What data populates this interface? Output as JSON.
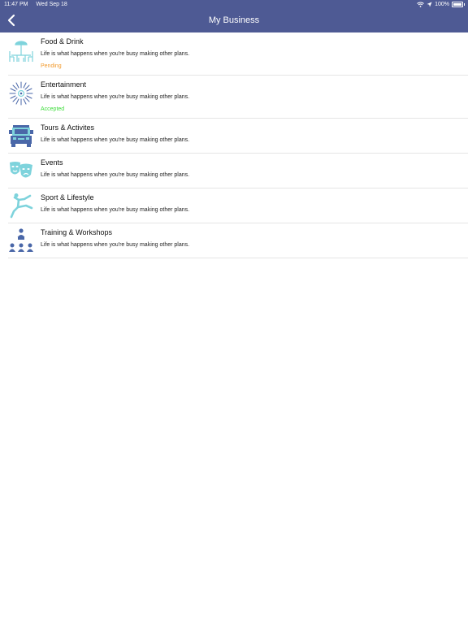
{
  "status_bar": {
    "time": "11:47 PM",
    "date": "Wed Sep 18",
    "battery": "100%"
  },
  "nav": {
    "title": "My Business",
    "back_icon": "chevron-left-icon"
  },
  "colors": {
    "header": "#4e5a94",
    "pending": "#f29a2e",
    "accepted": "#3ddc3a",
    "icon_teal": "#7ed3dc",
    "icon_blue": "#4a67a8"
  },
  "items": [
    {
      "name": "Food & Drink",
      "description": "Life is what happens when you're busy making other plans.",
      "status": "Pending",
      "icon": "food-drink-icon"
    },
    {
      "name": "Entertainment",
      "description": "Life is what happens when you're busy making other plans.",
      "status": "Accepted",
      "icon": "fireworks-icon"
    },
    {
      "name": "Tours & Activites",
      "description": "Life is what happens when you're busy making other plans.",
      "icon": "tour-bus-icon"
    },
    {
      "name": "Events",
      "description": "Life is what happens when you're busy making other plans.",
      "icon": "theater-masks-icon"
    },
    {
      "name": "Sport & Lifestyle",
      "description": "Life is what happens when you're busy making other plans.",
      "icon": "athlete-icon"
    },
    {
      "name": "Training & Workshops",
      "description": "Life is what happens when you're busy making other plans.",
      "icon": "workshop-icon"
    }
  ]
}
